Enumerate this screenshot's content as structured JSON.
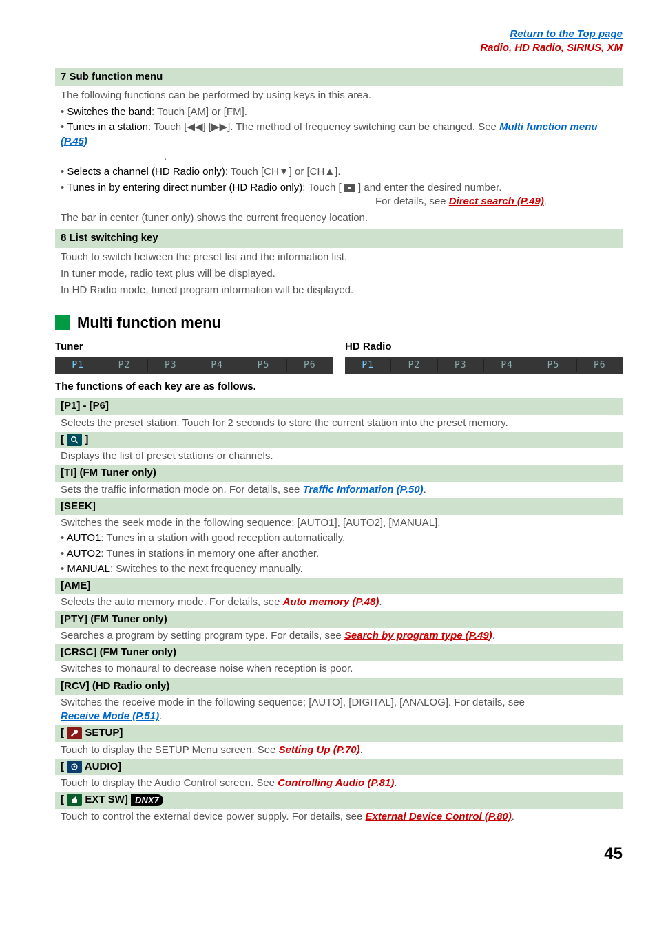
{
  "top": {
    "return": "Return to the Top page",
    "section": "Radio, HD Radio, SIRIUS, XM"
  },
  "item7": {
    "title": "7  Sub function menu",
    "intro": "The following functions can be performed by using keys in this area.",
    "b1_lead": "Switches the band",
    "b1_rest": ": Touch [AM] or [FM].",
    "b2_lead": "Tunes in a station",
    "b2_rest_a": ": Touch [◀◀] [▶▶]. The method of frequency switching can be changed. See ",
    "b2_link": "Multi function menu (P.45)",
    "b2_period": ".",
    "b3_lead": "Selects a channel (HD Radio only)",
    "b3_rest": ": Touch [CH▼] or [CH▲].",
    "b4_lead": "Tunes in by entering direct number (HD Radio only)",
    "b4_rest": ": Touch [       ] and enter the desired number.",
    "b4_tail_a": "For details, see ",
    "b4_link": "Direct search (P.49)",
    "b4_period": ".",
    "bar_note": "The bar in center (tuner only) shows the current frequency location."
  },
  "item8": {
    "title": "8  List switching key",
    "l1": "Touch to switch between the preset list and the information list.",
    "l2": "In tuner mode, radio text plus will be displayed.",
    "l3": "In HD Radio mode, tuned program information will be displayed."
  },
  "multi": {
    "heading": "Multi function menu",
    "tuner": "Tuner",
    "hd": "HD Radio",
    "presets": [
      "P1",
      "P2",
      "P3",
      "P4",
      "P5",
      "P6"
    ],
    "caption": "The functions of each key are as follows."
  },
  "keys": {
    "p1p6": {
      "hdr": "[P1] - [P6]",
      "desc": "Selects the preset station. Touch for 2 seconds to store the current station into the preset memory."
    },
    "mag": {
      "hdr_open": "[ ",
      "hdr_close": " ]",
      "desc": "Displays the list of preset stations or channels."
    },
    "ti": {
      "hdr": "[TI] (FM Tuner only)",
      "desc_a": "Sets the traffic information mode on. For details, see ",
      "link": "Traffic Information (P.50)",
      "period": "."
    },
    "seek": {
      "hdr": "[SEEK]",
      "desc": "Switches the seek mode in the following sequence; [AUTO1], [AUTO2], [MANUAL].",
      "a1_lead": "AUTO1",
      "a1_rest": ": Tunes in a station with good reception automatically.",
      "a2_lead": "AUTO2",
      "a2_rest": ": Tunes in stations in memory one after another.",
      "m_lead": "MANUAL",
      "m_rest": ": Switches to the next frequency manually."
    },
    "ame": {
      "hdr": "[AME]",
      "desc_a": "Selects the auto memory mode. For details, see ",
      "link": "Auto memory (P.48)",
      "period": "."
    },
    "pty": {
      "hdr": "[PTY] (FM Tuner only)",
      "desc_a": "Searches a program by setting program type. For details, see ",
      "link": "Search by program type (P.49)",
      "period": "."
    },
    "crsc": {
      "hdr": "[CRSC] (FM Tuner only)",
      "desc": "Switches to monaural to decrease noise when reception is poor."
    },
    "rcv": {
      "hdr": "[RCV] (HD Radio only)",
      "desc_a": "Switches the receive mode in the following sequence; [AUTO], [DIGITAL], [ANALOG]. For details, see ",
      "link": "Receive Mode (P.51)",
      "period": "."
    },
    "setup": {
      "hdr_a": "[ ",
      "hdr_b": " SETUP]",
      "desc_a": "Touch to display the SETUP Menu screen. See ",
      "link": "Setting Up (P.70)",
      "period": "."
    },
    "audio": {
      "hdr_a": "[ ",
      "hdr_b": " AUDIO]",
      "desc_a": "Touch to display the Audio Control screen. See ",
      "link": "Controlling Audio (P.81)",
      "period": "."
    },
    "ext": {
      "hdr_a": "[ ",
      "hdr_b": " EXT SW] ",
      "badge": "DNX7",
      "desc_a": "Touch to control the external device power supply. For details, see ",
      "link": "External Device Control (P.80)",
      "period": "."
    }
  },
  "page": "45"
}
